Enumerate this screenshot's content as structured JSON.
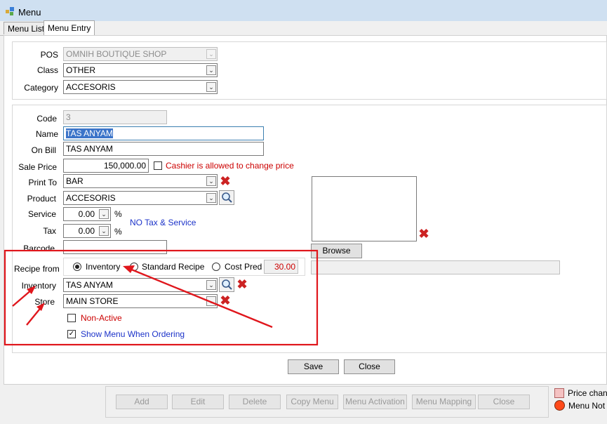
{
  "window": {
    "title": "Menu"
  },
  "tabs": [
    {
      "label": "Menu List",
      "active": false
    },
    {
      "label": "Menu Entry",
      "active": true
    }
  ],
  "top_group": {
    "pos": {
      "label": "POS",
      "value": "OMNIH BOUTIQUE SHOP"
    },
    "class": {
      "label": "Class",
      "value": "OTHER"
    },
    "category": {
      "label": "Category",
      "value": "ACCESORIS"
    }
  },
  "form": {
    "code": {
      "label": "Code",
      "value": "3"
    },
    "name": {
      "label": "Name",
      "value": "TAS ANYAM"
    },
    "on_bill": {
      "label": "On Bill",
      "value": "TAS ANYAM"
    },
    "sale_price": {
      "label": "Sale Price",
      "value": "150,000.00"
    },
    "cashier_change": {
      "label": "Cashier is allowed to change price",
      "checked": false
    },
    "print_to": {
      "label": "Print To",
      "value": "BAR"
    },
    "product": {
      "label": "Product",
      "value": "ACCESORIS"
    },
    "service": {
      "label": "Service",
      "value": "0.00",
      "unit": "%"
    },
    "tax": {
      "label": "Tax",
      "value": "0.00",
      "unit": "%"
    },
    "no_tax_note": "NO Tax & Service",
    "barcode": {
      "label": "Barcode",
      "value": ""
    },
    "recipe_from": {
      "label": "Recipe from",
      "options": [
        "Inventory",
        "Standard Recipe",
        "Cost Pred"
      ],
      "selected": "Inventory",
      "cost_pred_value": "30.00"
    },
    "inventory": {
      "label": "Inventory",
      "value": "TAS ANYAM"
    },
    "store": {
      "label": "Store",
      "value": "MAIN STORE"
    },
    "non_active": {
      "label": "Non-Active",
      "checked": false
    },
    "show_menu": {
      "label": "Show Menu When Ordering",
      "checked": true
    },
    "browse_label": "Browse"
  },
  "actions": {
    "save": "Save",
    "close": "Close"
  },
  "toolbar": [
    "Add",
    "Edit",
    "Delete",
    "Copy Menu",
    "Menu Activation",
    "Menu Mapping",
    "Close"
  ],
  "legend": [
    {
      "label": "Price chang",
      "color": "#f4c2c2"
    },
    {
      "label": "Menu Not S",
      "color": "#ff4a1a"
    }
  ],
  "annotation_color": "#e0161c"
}
